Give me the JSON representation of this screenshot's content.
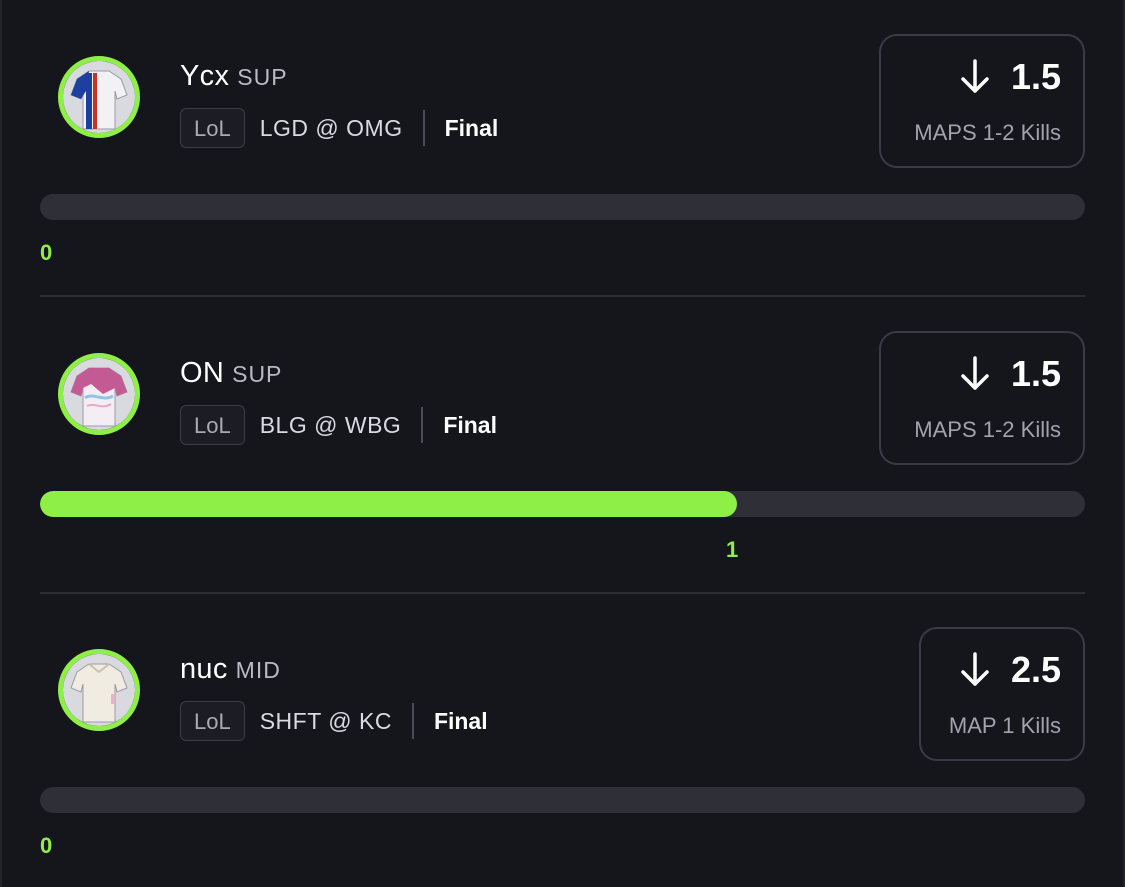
{
  "accent_color": "#8ef046",
  "picks": [
    {
      "player": "Ycx",
      "position": "SUP",
      "league": "LoL",
      "matchup": "LGD @ OMG",
      "status": "Final",
      "direction_icon": "arrow-down-icon",
      "line": "1.5",
      "market": "MAPS 1-2 Kills",
      "progress_value": "0",
      "progress_fraction": 0,
      "jersey_icon": "jersey-icon"
    },
    {
      "player": "ON",
      "position": "SUP",
      "league": "LoL",
      "matchup": "BLG @ WBG",
      "status": "Final",
      "direction_icon": "arrow-down-icon",
      "line": "1.5",
      "market": "MAPS 1-2 Kills",
      "progress_value": "1",
      "progress_fraction": 0.667,
      "jersey_icon": "jersey-icon"
    },
    {
      "player": "nuc",
      "position": "MID",
      "league": "LoL",
      "matchup": "SHFT @ KC",
      "status": "Final",
      "direction_icon": "arrow-down-icon",
      "line": "2.5",
      "market": "MAP 1 Kills",
      "progress_value": "0",
      "progress_fraction": 0,
      "jersey_icon": "jersey-icon"
    }
  ]
}
